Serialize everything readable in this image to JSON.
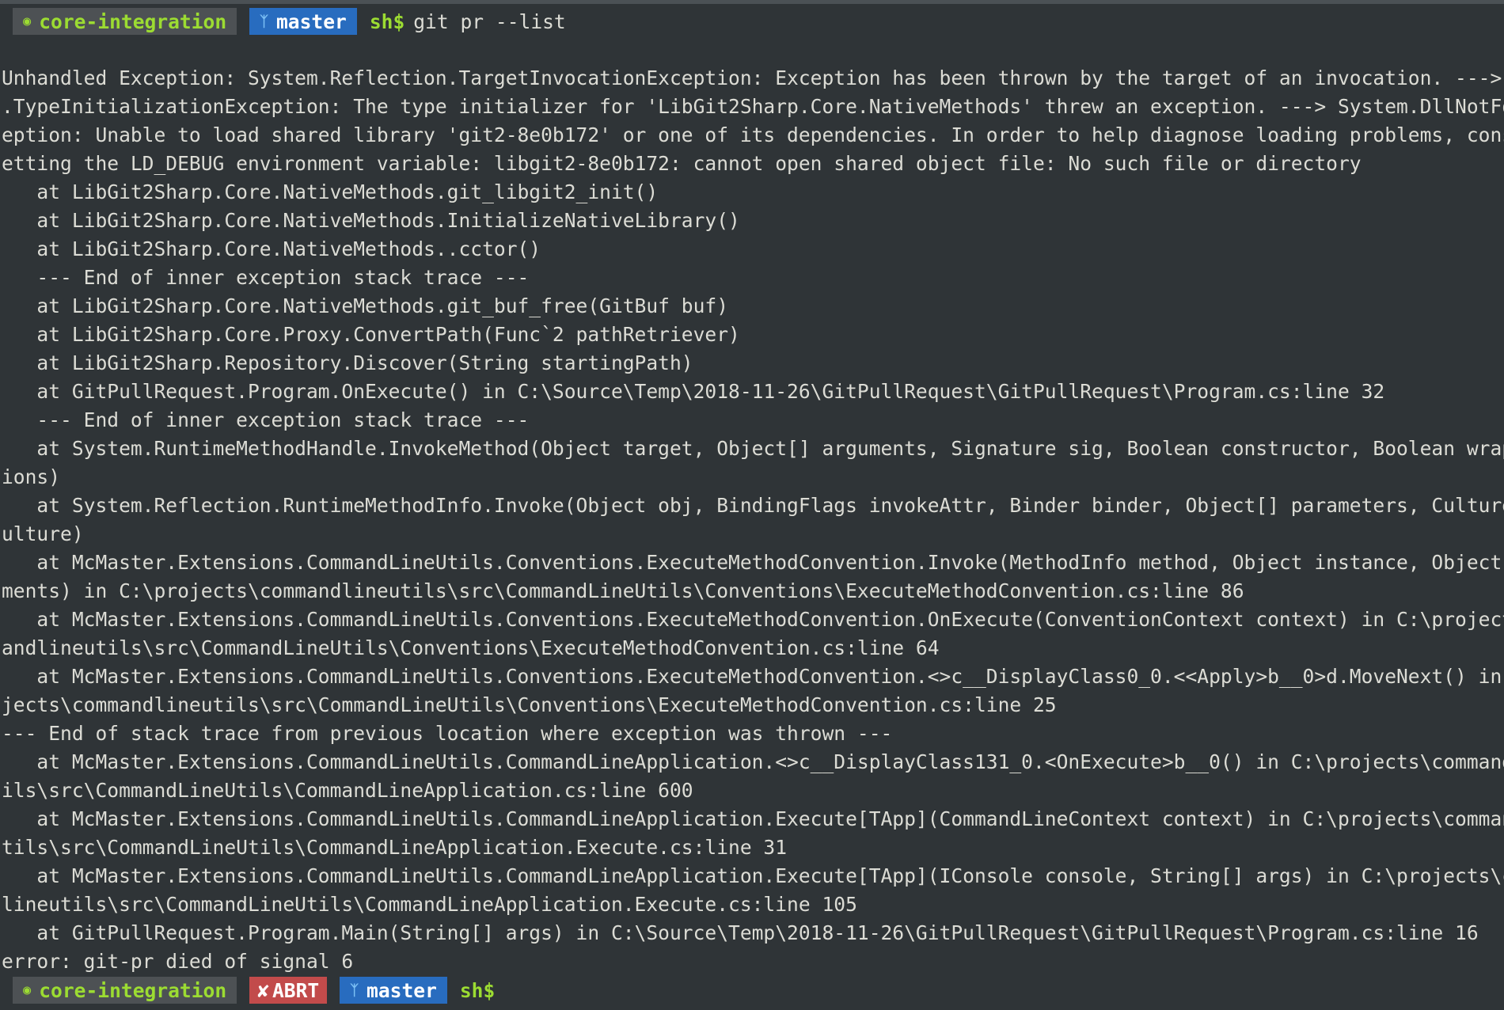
{
  "prompt_top": {
    "folder": "core-integration",
    "branch": "master",
    "ps1": "sh$",
    "command": "git pr --list"
  },
  "output_lines": [
    "Unhandled Exception: System.Reflection.TargetInvocationException: Exception has been thrown by the target of an invocation. ---> System",
    ".TypeInitializationException: The type initializer for 'LibGit2Sharp.Core.NativeMethods' threw an exception. ---> System.DllNotFoundExc",
    "eption: Unable to load shared library 'git2-8e0b172' or one of its dependencies. In order to help diagnose loading problems, consider s",
    "etting the LD_DEBUG environment variable: libgit2-8e0b172: cannot open shared object file: No such file or directory",
    "   at LibGit2Sharp.Core.NativeMethods.git_libgit2_init()",
    "   at LibGit2Sharp.Core.NativeMethods.InitializeNativeLibrary()",
    "   at LibGit2Sharp.Core.NativeMethods..cctor()",
    "   --- End of inner exception stack trace ---",
    "   at LibGit2Sharp.Core.NativeMethods.git_buf_free(GitBuf buf)",
    "   at LibGit2Sharp.Core.Proxy.ConvertPath(Func`2 pathRetriever)",
    "   at LibGit2Sharp.Repository.Discover(String startingPath)",
    "   at GitPullRequest.Program.OnExecute() in C:\\Source\\Temp\\2018-11-26\\GitPullRequest\\GitPullRequest\\Program.cs:line 32",
    "   --- End of inner exception stack trace ---",
    "   at System.RuntimeMethodHandle.InvokeMethod(Object target, Object[] arguments, Signature sig, Boolean constructor, Boolean wrapExcept",
    "ions)",
    "   at System.Reflection.RuntimeMethodInfo.Invoke(Object obj, BindingFlags invokeAttr, Binder binder, Object[] parameters, CultureInfo c",
    "ulture)",
    "   at McMaster.Extensions.CommandLineUtils.Conventions.ExecuteMethodConvention.Invoke(MethodInfo method, Object instance, Object[] argu",
    "ments) in C:\\projects\\commandlineutils\\src\\CommandLineUtils\\Conventions\\ExecuteMethodConvention.cs:line 86",
    "   at McMaster.Extensions.CommandLineUtils.Conventions.ExecuteMethodConvention.OnExecute(ConventionContext context) in C:\\projects\\comm",
    "andlineutils\\src\\CommandLineUtils\\Conventions\\ExecuteMethodConvention.cs:line 64",
    "   at McMaster.Extensions.CommandLineUtils.Conventions.ExecuteMethodConvention.<>c__DisplayClass0_0.<<Apply>b__0>d.MoveNext() in C:\\pro",
    "jects\\commandlineutils\\src\\CommandLineUtils\\Conventions\\ExecuteMethodConvention.cs:line 25",
    "--- End of stack trace from previous location where exception was thrown ---",
    "   at McMaster.Extensions.CommandLineUtils.CommandLineApplication.<>c__DisplayClass131_0.<OnExecute>b__0() in C:\\projects\\commandlineut",
    "ils\\src\\CommandLineUtils\\CommandLineApplication.cs:line 600",
    "   at McMaster.Extensions.CommandLineUtils.CommandLineApplication.Execute[TApp](CommandLineContext context) in C:\\projects\\commandlineu",
    "tils\\src\\CommandLineUtils\\CommandLineApplication.Execute.cs:line 31",
    "   at McMaster.Extensions.CommandLineUtils.CommandLineApplication.Execute[TApp](IConsole console, String[] args) in C:\\projects\\command",
    "lineutils\\src\\CommandLineUtils\\CommandLineApplication.Execute.cs:line 105",
    "   at GitPullRequest.Program.Main(String[] args) in C:\\Source\\Temp\\2018-11-26\\GitPullRequest\\GitPullRequest\\Program.cs:line 16",
    "error: git-pr died of signal 6"
  ],
  "prompt_bottom": {
    "folder": "core-integration",
    "status": "ABRT",
    "branch": "master",
    "ps1": "sh$"
  },
  "icons": {
    "folder": "package-icon",
    "branch": "git-branch-icon",
    "status": "x-mark-icon"
  },
  "colors": {
    "background": "#2f3437",
    "prompt_green": "#9cdc32",
    "branch_blue": "#286cbf",
    "abrt_red": "#c24b4b",
    "folder_segment": "#4d5154"
  }
}
